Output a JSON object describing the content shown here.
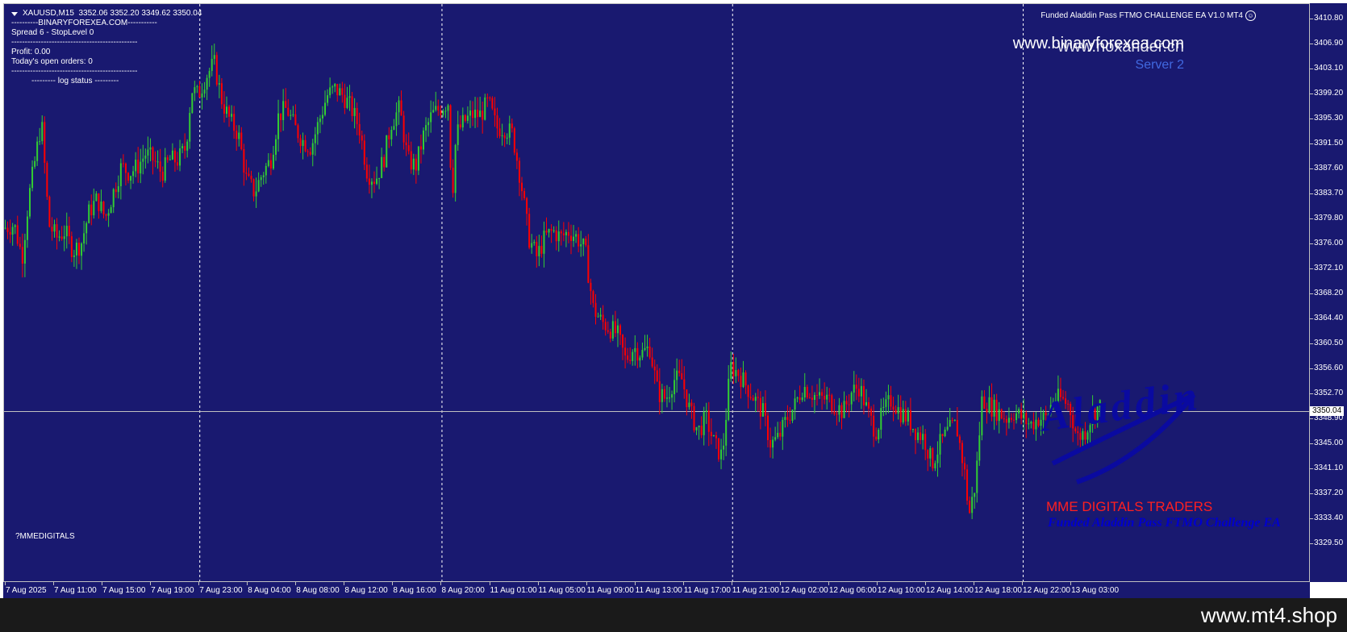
{
  "chart_header": {
    "symbol_info": "XAUUSD,M15  3352.06 3352.20 3349.62 3350.04",
    "ea_title": "Funded Aladdin Pass FTMO CHALLENGE EA V1.0 MT4"
  },
  "info_panel": {
    "lines": [
      "----------BINARYFOREXEA.COM-----------",
      "Spread 6 - StopLevel 0",
      "-----------------------------------------------",
      "Profit: 0.00",
      "Today's open orders: 0",
      "-----------------------------------------------",
      "         --------- log status ---------"
    ]
  },
  "watermarks": {
    "site_a": "www.binaryforexea.com",
    "site_b": "www.noxander.cn",
    "server": "Server 2",
    "logo_text": "Aladdin",
    "brand": "MME DIGITALS TRADERS",
    "brand_sub": "Funded Aladdin Pass FTMO Challenge EA",
    "bottom_left": "?MMEDIGITALS",
    "footer_url": "www.mt4.shop"
  },
  "colors": {
    "background": "#191970",
    "bull": "#32cd32",
    "bear": "#ff0000",
    "grid": "#ffffff",
    "axis_text": "#ffffff",
    "brand_red": "#ff2020",
    "server_blue": "#4169e1"
  },
  "chart_data": {
    "type": "candlestick",
    "symbol": "XAUUSD",
    "timeframe": "M15",
    "current_price": 3350.04,
    "ylim": [
      3329.5,
      3410.8
    ],
    "price_ticks": [
      "3410.80",
      "3406.90",
      "3403.10",
      "3399.20",
      "3395.30",
      "3391.50",
      "3387.60",
      "3383.70",
      "3379.80",
      "3376.00",
      "3372.10",
      "3368.20",
      "3364.40",
      "3360.50",
      "3356.60",
      "3352.70",
      "3348.90",
      "3345.00",
      "3341.10",
      "3337.20",
      "3333.40",
      "3329.50"
    ],
    "time_ticks": [
      "7 Aug 2025",
      "7 Aug 11:00",
      "7 Aug 15:00",
      "7 Aug 19:00",
      "7 Aug 23:00",
      "8 Aug 04:00",
      "8 Aug 08:00",
      "8 Aug 12:00",
      "8 Aug 16:00",
      "8 Aug 20:00",
      "11 Aug 01:00",
      "11 Aug 05:00",
      "11 Aug 09:00",
      "11 Aug 13:00",
      "11 Aug 17:00",
      "11 Aug 21:00",
      "12 Aug 02:00",
      "12 Aug 06:00",
      "12 Aug 10:00",
      "12 Aug 14:00",
      "12 Aug 18:00",
      "12 Aug 22:00",
      "13 Aug 03:00"
    ],
    "session_separators": [
      "7 Aug 23:00",
      "8 Aug 20:00",
      "11 Aug 21:00",
      "12 Aug 22:00"
    ],
    "path_anchors": [
      [
        0,
        3378.5
      ],
      [
        12,
        3379
      ],
      [
        22,
        3374
      ],
      [
        30,
        3383
      ],
      [
        38,
        3389
      ],
      [
        46,
        3395
      ],
      [
        55,
        3379
      ],
      [
        65,
        3377
      ],
      [
        75,
        3378
      ],
      [
        85,
        3375
      ],
      [
        95,
        3376
      ],
      [
        105,
        3381
      ],
      [
        115,
        3383
      ],
      [
        125,
        3380
      ],
      [
        135,
        3384
      ],
      [
        145,
        3388
      ],
      [
        155,
        3387
      ],
      [
        165,
        3388
      ],
      [
        175,
        3390
      ],
      [
        185,
        3389
      ],
      [
        195,
        3387
      ],
      [
        205,
        3389
      ],
      [
        215,
        3389
      ],
      [
        225,
        3391
      ],
      [
        232,
        3400
      ],
      [
        240,
        3399
      ],
      [
        250,
        3402
      ],
      [
        260,
        3404
      ],
      [
        270,
        3398
      ],
      [
        280,
        3395
      ],
      [
        290,
        3393
      ],
      [
        300,
        3386
      ],
      [
        310,
        3384
      ],
      [
        320,
        3387
      ],
      [
        330,
        3389
      ],
      [
        340,
        3396
      ],
      [
        350,
        3397
      ],
      [
        360,
        3394
      ],
      [
        370,
        3392
      ],
      [
        380,
        3391
      ],
      [
        390,
        3395
      ],
      [
        400,
        3399
      ],
      [
        410,
        3400
      ],
      [
        420,
        3399
      ],
      [
        430,
        3397
      ],
      [
        440,
        3394
      ],
      [
        450,
        3387
      ],
      [
        460,
        3386
      ],
      [
        470,
        3389
      ],
      [
        480,
        3395
      ],
      [
        490,
        3397
      ],
      [
        500,
        3389
      ],
      [
        510,
        3388
      ],
      [
        520,
        3393
      ],
      [
        530,
        3396
      ],
      [
        540,
        3397
      ],
      [
        550,
        3398
      ],
      [
        555,
        3383
      ],
      [
        560,
        3393
      ],
      [
        570,
        3395
      ],
      [
        580,
        3396
      ],
      [
        590,
        3396
      ],
      [
        600,
        3398
      ],
      [
        610,
        3394
      ],
      [
        620,
        3394
      ],
      [
        630,
        3393
      ],
      [
        640,
        3386
      ],
      [
        650,
        3377
      ],
      [
        660,
        3374
      ],
      [
        670,
        3377
      ],
      [
        680,
        3378
      ],
      [
        690,
        3377
      ],
      [
        700,
        3378
      ],
      [
        710,
        3377
      ],
      [
        720,
        3375
      ],
      [
        730,
        3366
      ],
      [
        740,
        3364
      ],
      [
        750,
        3363
      ],
      [
        760,
        3362
      ],
      [
        770,
        3358
      ],
      [
        780,
        3360
      ],
      [
        790,
        3359
      ],
      [
        800,
        3360
      ],
      [
        810,
        3353
      ],
      [
        820,
        3352
      ],
      [
        830,
        3355
      ],
      [
        840,
        3355
      ],
      [
        850,
        3350
      ],
      [
        860,
        3347
      ],
      [
        870,
        3349
      ],
      [
        880,
        3345
      ],
      [
        890,
        3343
      ],
      [
        900,
        3357
      ],
      [
        910,
        3356
      ],
      [
        920,
        3354
      ],
      [
        930,
        3352
      ],
      [
        940,
        3350
      ],
      [
        950,
        3345
      ],
      [
        960,
        3346
      ],
      [
        970,
        3349
      ],
      [
        980,
        3351
      ],
      [
        990,
        3354
      ],
      [
        1000,
        3353
      ],
      [
        1010,
        3352
      ],
      [
        1020,
        3352
      ],
      [
        1030,
        3351
      ],
      [
        1040,
        3350
      ],
      [
        1050,
        3353
      ],
      [
        1060,
        3354
      ],
      [
        1070,
        3350
      ],
      [
        1080,
        3347
      ],
      [
        1090,
        3350
      ],
      [
        1100,
        3352
      ],
      [
        1110,
        3350
      ],
      [
        1120,
        3349
      ],
      [
        1130,
        3347
      ],
      [
        1140,
        3346
      ],
      [
        1150,
        3342
      ],
      [
        1160,
        3345
      ],
      [
        1170,
        3347
      ],
      [
        1180,
        3348
      ],
      [
        1190,
        3341
      ],
      [
        1196,
        3334
      ],
      [
        1204,
        3339
      ],
      [
        1212,
        3352
      ],
      [
        1222,
        3351
      ],
      [
        1232,
        3350
      ],
      [
        1242,
        3349
      ],
      [
        1252,
        3350
      ],
      [
        1262,
        3349
      ],
      [
        1272,
        3348
      ],
      [
        1282,
        3349
      ],
      [
        1292,
        3349
      ],
      [
        1300,
        3352
      ],
      [
        1310,
        3352
      ],
      [
        1320,
        3351
      ],
      [
        1330,
        3346
      ],
      [
        1340,
        3347
      ],
      [
        1350,
        3350
      ],
      [
        1360,
        3351
      ]
    ]
  }
}
